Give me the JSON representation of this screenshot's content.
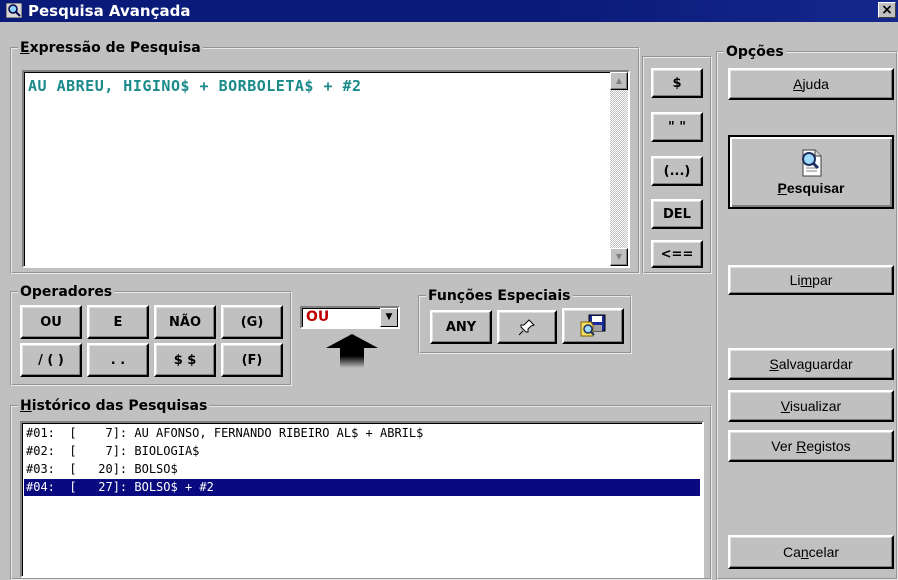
{
  "window": {
    "title": "Pesquisa Avançada",
    "close_label": "×"
  },
  "expression": {
    "group_label": "Expressão de Pesquisa",
    "group_accel": "E",
    "value": "AU ABREU, HIGINO$ + BORBOLETA$ + #2"
  },
  "expr_tools": [
    "$",
    "\" \"",
    "(...)",
    "DEL",
    "<=="
  ],
  "options": {
    "group_label": "Opções",
    "help": "Ajuda",
    "help_accel": "A",
    "search": "Pesquisar",
    "search_accel": "P",
    "clear": "Limpar",
    "clear_accel": "m",
    "save": "Salvaguardar",
    "save_accel": "S",
    "view": "Visualizar",
    "view_accel": "V",
    "records": "Ver Registos",
    "records_accel": "R",
    "cancel": "Cancelar",
    "cancel_accel": "n"
  },
  "operators": {
    "group_label": "Operadores",
    "row1": [
      "OU",
      "E",
      "NÃO",
      "(G)"
    ],
    "row2": [
      "/ ( )",
      ". .",
      "$ $",
      "(F)"
    ]
  },
  "combo": {
    "selected": "OU"
  },
  "special": {
    "group_label": "Funções Especiais",
    "any": "ANY"
  },
  "history": {
    "group_label": "Histórico das Pesquisas",
    "group_accel": "H",
    "rows": [
      "#01:  [    7]: AU AFONSO, FERNANDO RIBEIRO AL$ + ABRIL$",
      "#02:  [    7]: BIOLOGIA$",
      "#03:  [   20]: BOLSO$",
      "#04:  [   27]: BOLSO$ + #2"
    ],
    "selected_index": 3
  },
  "colors": {
    "title_bar": "#0a1a78",
    "expression_text": "#1a8a8a",
    "operator_value": "#c00000",
    "selection": "#0a0a80"
  },
  "icons": [
    "search-window-icon",
    "close-icon",
    "scroll-up-icon",
    "scroll-down-icon",
    "dropdown-arrow-icon",
    "up-arrow-icon",
    "pin-icon",
    "save-search-icon",
    "search-document-icon"
  ]
}
